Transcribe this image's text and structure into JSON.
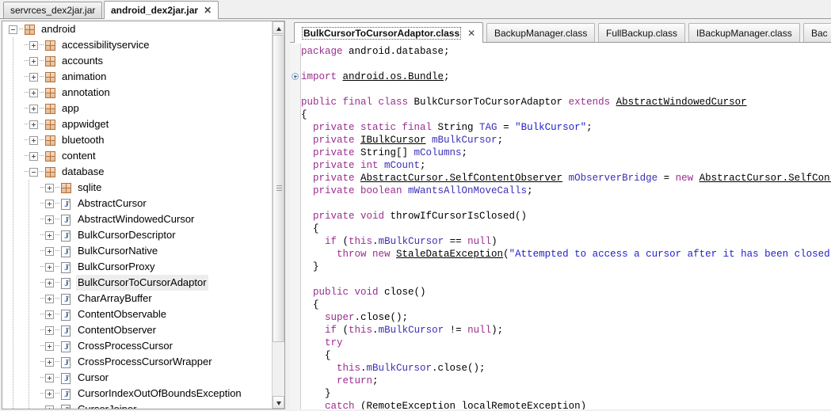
{
  "window": {
    "jar_tabs": [
      {
        "label": "servrces_dex2jar.jar",
        "active": false,
        "close": ""
      },
      {
        "label": "android_dex2jar.jar",
        "active": true,
        "close": "✕"
      }
    ]
  },
  "tree": {
    "root": "android",
    "nodes": [
      {
        "label": "android",
        "type": "package",
        "depth": 0,
        "state": "expanded",
        "selected": false
      },
      {
        "label": "accessibilityservice",
        "type": "package",
        "depth": 1,
        "state": "collapsed",
        "selected": false
      },
      {
        "label": "accounts",
        "type": "package",
        "depth": 1,
        "state": "collapsed",
        "selected": false
      },
      {
        "label": "animation",
        "type": "package",
        "depth": 1,
        "state": "collapsed",
        "selected": false
      },
      {
        "label": "annotation",
        "type": "package",
        "depth": 1,
        "state": "collapsed",
        "selected": false
      },
      {
        "label": "app",
        "type": "package",
        "depth": 1,
        "state": "collapsed",
        "selected": false
      },
      {
        "label": "appwidget",
        "type": "package",
        "depth": 1,
        "state": "collapsed",
        "selected": false
      },
      {
        "label": "bluetooth",
        "type": "package",
        "depth": 1,
        "state": "collapsed",
        "selected": false
      },
      {
        "label": "content",
        "type": "package",
        "depth": 1,
        "state": "collapsed",
        "selected": false
      },
      {
        "label": "database",
        "type": "package",
        "depth": 1,
        "state": "expanded",
        "selected": false
      },
      {
        "label": "sqlite",
        "type": "package",
        "depth": 2,
        "state": "collapsed",
        "selected": false
      },
      {
        "label": "AbstractCursor",
        "type": "class",
        "depth": 2,
        "state": "collapsed",
        "selected": false
      },
      {
        "label": "AbstractWindowedCursor",
        "type": "class",
        "depth": 2,
        "state": "collapsed",
        "selected": false
      },
      {
        "label": "BulkCursorDescriptor",
        "type": "class",
        "depth": 2,
        "state": "collapsed",
        "selected": false
      },
      {
        "label": "BulkCursorNative",
        "type": "class",
        "depth": 2,
        "state": "collapsed",
        "selected": false
      },
      {
        "label": "BulkCursorProxy",
        "type": "class",
        "depth": 2,
        "state": "collapsed",
        "selected": false
      },
      {
        "label": "BulkCursorToCursorAdaptor",
        "type": "class",
        "depth": 2,
        "state": "collapsed",
        "selected": true
      },
      {
        "label": "CharArrayBuffer",
        "type": "class",
        "depth": 2,
        "state": "collapsed",
        "selected": false
      },
      {
        "label": "ContentObservable",
        "type": "class",
        "depth": 2,
        "state": "collapsed",
        "selected": false
      },
      {
        "label": "ContentObserver",
        "type": "class",
        "depth": 2,
        "state": "collapsed",
        "selected": false
      },
      {
        "label": "CrossProcessCursor",
        "type": "class",
        "depth": 2,
        "state": "collapsed",
        "selected": false
      },
      {
        "label": "CrossProcessCursorWrapper",
        "type": "class",
        "depth": 2,
        "state": "collapsed",
        "selected": false
      },
      {
        "label": "Cursor",
        "type": "class",
        "depth": 2,
        "state": "collapsed",
        "selected": false
      },
      {
        "label": "CursorIndexOutOfBoundsException",
        "type": "class",
        "depth": 2,
        "state": "collapsed",
        "selected": false
      },
      {
        "label": "CursorJoiner",
        "type": "class",
        "depth": 2,
        "state": "collapsed",
        "selected": false
      }
    ],
    "scrollbar": {
      "up_arrow": "▲",
      "down_arrow": "▼"
    }
  },
  "editor": {
    "tabs": [
      {
        "label": "BulkCursorToCursorAdaptor.class",
        "active": true,
        "close": "✕"
      },
      {
        "label": "BackupManager.class",
        "active": false,
        "close": ""
      },
      {
        "label": "FullBackup.class",
        "active": false,
        "close": ""
      },
      {
        "label": "IBackupManager.class",
        "active": false,
        "close": ""
      },
      {
        "label": "Bac",
        "active": false,
        "close": ""
      }
    ],
    "fold_marker": "⊕",
    "code_lines": [
      [
        {
          "t": "package ",
          "c": "kw"
        },
        {
          "t": "android.database;",
          "c": "pl"
        }
      ],
      [],
      [
        {
          "t": "import ",
          "c": "kw"
        },
        {
          "t": "android.os.Bundle",
          "c": "typ"
        },
        {
          "t": ";",
          "c": "pl"
        }
      ],
      [],
      [
        {
          "t": "public final class ",
          "c": "kw"
        },
        {
          "t": "BulkCursorToCursorAdaptor ",
          "c": "pl"
        },
        {
          "t": "extends ",
          "c": "kw"
        },
        {
          "t": "AbstractWindowedCursor",
          "c": "typ"
        }
      ],
      [
        {
          "t": "{",
          "c": "pl"
        }
      ],
      [
        {
          "t": "  private static final ",
          "c": "kw"
        },
        {
          "t": "String ",
          "c": "pl"
        },
        {
          "t": "TAG",
          "c": "fld"
        },
        {
          "t": " = ",
          "c": "pl"
        },
        {
          "t": "\"BulkCursor\"",
          "c": "str"
        },
        {
          "t": ";",
          "c": "pl"
        }
      ],
      [
        {
          "t": "  private ",
          "c": "kw"
        },
        {
          "t": "IBulkCursor",
          "c": "typ"
        },
        {
          "t": " ",
          "c": "pl"
        },
        {
          "t": "mBulkCursor",
          "c": "fld"
        },
        {
          "t": ";",
          "c": "pl"
        }
      ],
      [
        {
          "t": "  private ",
          "c": "kw"
        },
        {
          "t": "String[] ",
          "c": "pl"
        },
        {
          "t": "mColumns",
          "c": "fld"
        },
        {
          "t": ";",
          "c": "pl"
        }
      ],
      [
        {
          "t": "  private int ",
          "c": "kw"
        },
        {
          "t": "mCount",
          "c": "fld"
        },
        {
          "t": ";",
          "c": "pl"
        }
      ],
      [
        {
          "t": "  private ",
          "c": "kw"
        },
        {
          "t": "AbstractCursor.SelfContentObserver",
          "c": "typ"
        },
        {
          "t": " ",
          "c": "pl"
        },
        {
          "t": "mObserverBridge",
          "c": "fld"
        },
        {
          "t": " = ",
          "c": "pl"
        },
        {
          "t": "new ",
          "c": "kw"
        },
        {
          "t": "AbstractCursor.SelfContentOb",
          "c": "typ"
        }
      ],
      [
        {
          "t": "  private boolean ",
          "c": "kw"
        },
        {
          "t": "mWantsAllOnMoveCalls",
          "c": "fld"
        },
        {
          "t": ";",
          "c": "pl"
        }
      ],
      [],
      [
        {
          "t": "  private void ",
          "c": "kw"
        },
        {
          "t": "throwIfCursorIsClosed()",
          "c": "pl"
        }
      ],
      [
        {
          "t": "  {",
          "c": "pl"
        }
      ],
      [
        {
          "t": "    if ",
          "c": "kw"
        },
        {
          "t": "(",
          "c": "pl"
        },
        {
          "t": "this",
          "c": "kw"
        },
        {
          "t": ".",
          "c": "pl"
        },
        {
          "t": "mBulkCursor",
          "c": "fld"
        },
        {
          "t": " == ",
          "c": "pl"
        },
        {
          "t": "null",
          "c": "kw"
        },
        {
          "t": ")",
          "c": "pl"
        }
      ],
      [
        {
          "t": "      throw new ",
          "c": "kw"
        },
        {
          "t": "StaleDataException",
          "c": "typ"
        },
        {
          "t": "(",
          "c": "pl"
        },
        {
          "t": "\"Attempted to access a cursor after it has been closed.\"",
          "c": "str"
        },
        {
          "t": ");",
          "c": "pl"
        }
      ],
      [
        {
          "t": "  }",
          "c": "pl"
        }
      ],
      [],
      [
        {
          "t": "  public void ",
          "c": "kw"
        },
        {
          "t": "close()",
          "c": "pl"
        }
      ],
      [
        {
          "t": "  {",
          "c": "pl"
        }
      ],
      [
        {
          "t": "    super",
          "c": "kw"
        },
        {
          "t": ".close();",
          "c": "pl"
        }
      ],
      [
        {
          "t": "    if ",
          "c": "kw"
        },
        {
          "t": "(",
          "c": "pl"
        },
        {
          "t": "this",
          "c": "kw"
        },
        {
          "t": ".",
          "c": "pl"
        },
        {
          "t": "mBulkCursor",
          "c": "fld"
        },
        {
          "t": " != ",
          "c": "pl"
        },
        {
          "t": "null",
          "c": "kw"
        },
        {
          "t": ");",
          "c": "pl"
        }
      ],
      [
        {
          "t": "    try",
          "c": "kw"
        }
      ],
      [
        {
          "t": "    {",
          "c": "pl"
        }
      ],
      [
        {
          "t": "      this",
          "c": "kw"
        },
        {
          "t": ".",
          "c": "pl"
        },
        {
          "t": "mBulkCursor",
          "c": "fld"
        },
        {
          "t": ".close();",
          "c": "pl"
        }
      ],
      [
        {
          "t": "      return",
          "c": "kw"
        },
        {
          "t": ";",
          "c": "pl"
        }
      ],
      [
        {
          "t": "    }",
          "c": "pl"
        }
      ],
      [
        {
          "t": "    catch ",
          "c": "kw"
        },
        {
          "t": "(",
          "c": "pl"
        },
        {
          "t": "RemoteException",
          "c": "typ"
        },
        {
          "t": " localRemoteException)",
          "c": "pl"
        }
      ]
    ]
  },
  "colors": {
    "keyword": "#9b2d8f",
    "string": "#2222cc",
    "field": "#3b2fb5",
    "package_icon": "#b5713a",
    "class_icon_letter": "#2a4fa8",
    "selection": "#ededed",
    "editor_bg": "#ffffff",
    "chrome_bg": "#f0f0f0"
  }
}
